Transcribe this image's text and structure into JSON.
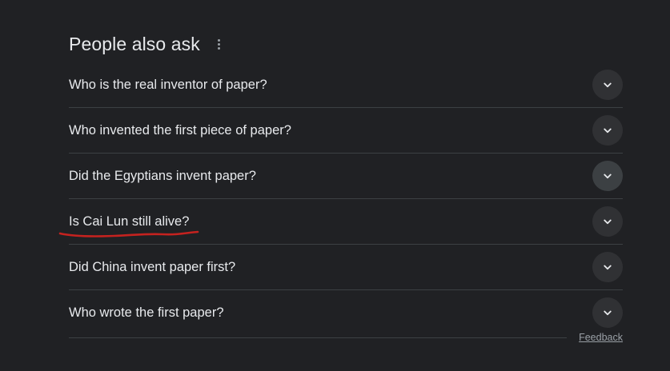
{
  "section": {
    "title": "People also ask",
    "more_icon": "more-vert-icon"
  },
  "questions": [
    {
      "text": "Who is the real inventor of paper?",
      "expand_icon": "chevron-down-icon"
    },
    {
      "text": "Who invented the first piece of paper?",
      "expand_icon": "chevron-down-icon"
    },
    {
      "text": "Did the Egyptians invent paper?",
      "expand_icon": "chevron-down-icon"
    },
    {
      "text": "Is Cai Lun still alive?",
      "expand_icon": "chevron-down-icon",
      "annotation": "red-handdrawn-underline"
    },
    {
      "text": "Did China invent paper first?",
      "expand_icon": "chevron-down-icon"
    },
    {
      "text": "Who wrote the first paper?",
      "expand_icon": "chevron-down-icon"
    }
  ],
  "footer": {
    "feedback_label": "Feedback"
  },
  "colors": {
    "background": "#202124",
    "text": "#e8eaed",
    "muted": "#9aa0a6",
    "divider": "#3c4043",
    "annotation": "#c5221f"
  }
}
